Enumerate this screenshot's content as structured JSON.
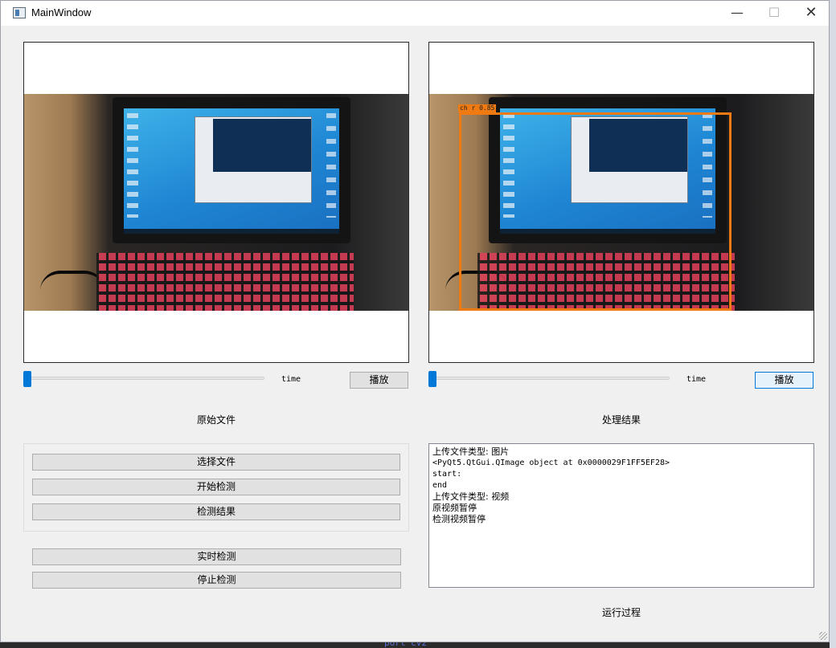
{
  "window": {
    "title": "MainWindow",
    "min_glyph": "—",
    "max_glyph": "☐",
    "close_glyph": "✕"
  },
  "left_panel": {
    "time_label": "time",
    "play_label": "播放",
    "caption": "原始文件",
    "buttons": {
      "select_file": "选择文件",
      "start_detect": "开始检测",
      "detect_result": "检测结果",
      "realtime_detect": "实时检测",
      "stop_detect": "停止检测"
    }
  },
  "right_panel": {
    "time_label": "time",
    "play_label": "播放",
    "caption": "处理结果",
    "detection_label": "ch  r 0.85",
    "detection_color": "#f07a12"
  },
  "log": {
    "lines": [
      "上传文件类型: 图片",
      "<PyQt5.QtGui.QImage object at 0x0000029F1FF5EF28>",
      "start:",
      "end",
      "上传文件类型: 视频",
      "原视频暂停",
      "检测视频暂停"
    ],
    "caption": "运行过程"
  },
  "background_text": "port cv2",
  "colors": {
    "accent": "#0078d7",
    "window_bg": "#f0f0f0",
    "button_bg": "#e1e1e1"
  },
  "icons": [
    "app-icon",
    "minimize-icon",
    "maximize-icon",
    "close-icon"
  ]
}
